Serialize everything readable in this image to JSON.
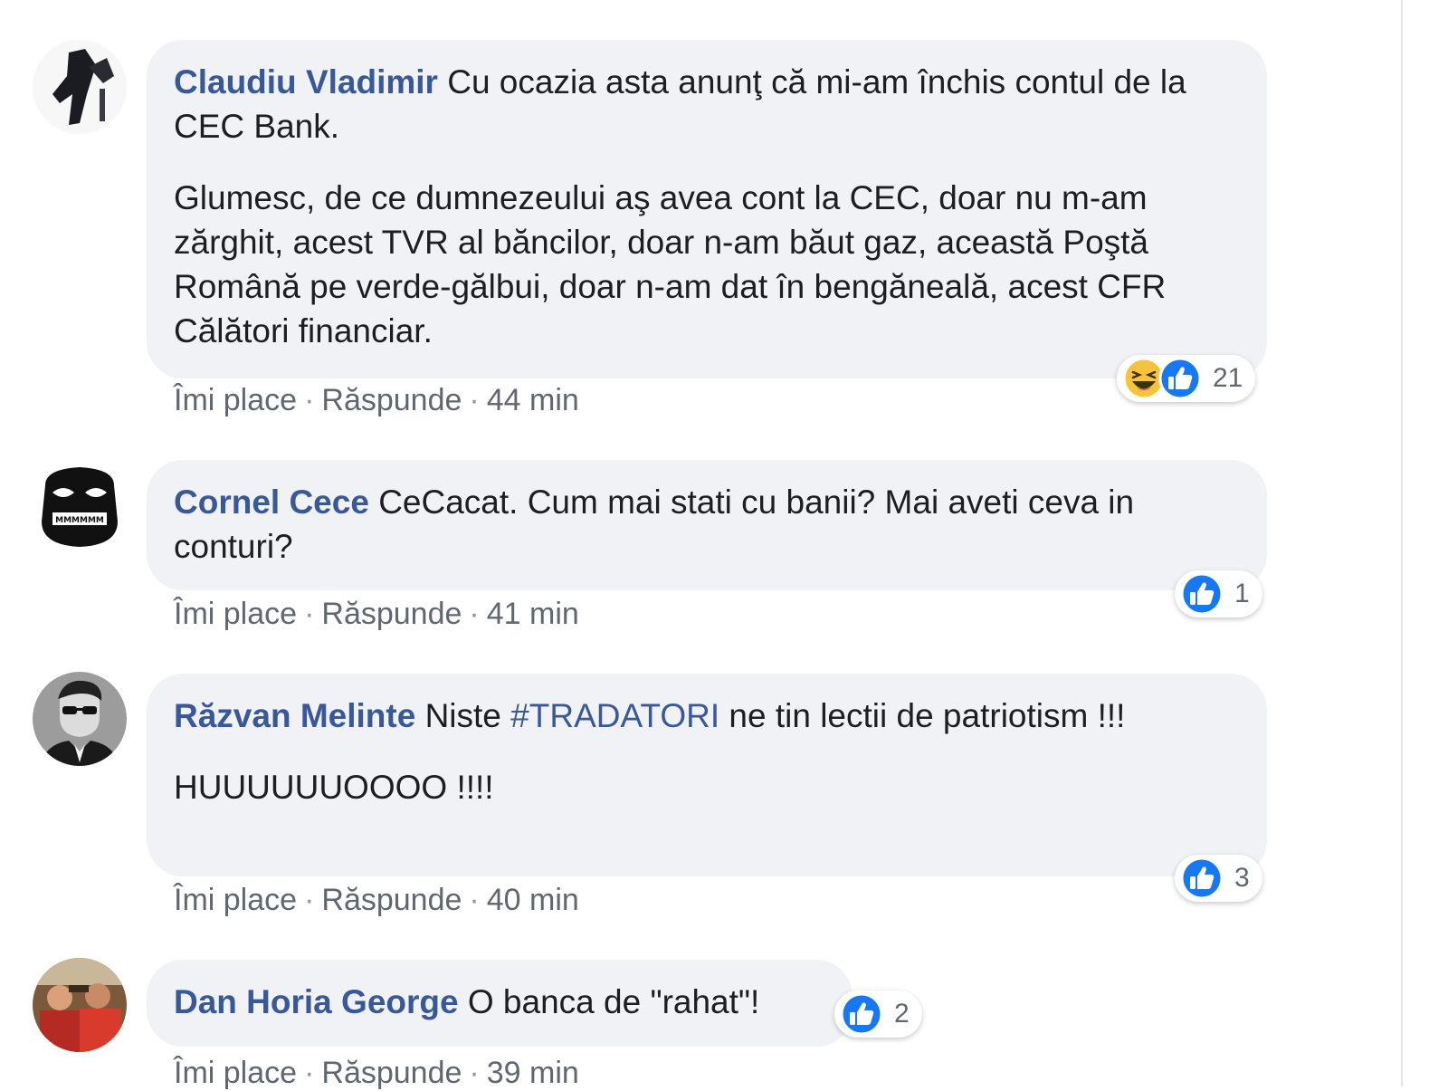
{
  "comments": [
    {
      "author": "Claudiu Vladimir",
      "text_first": "Cu ocazia asta anunţ că mi-am închis contul de la CEC Bank.",
      "text_second": "Glumesc, de ce dumnezeului aş avea cont la CEC, doar nu m-am zărghit, acest TVR al băncilor, doar n-am băut gaz, această Poştă Română pe verde-gălbui, doar n-am dat în bengăneală, acest CFR Călători financiar.",
      "like": "Îmi place",
      "reply": "Răspunde",
      "time": "44 min",
      "reaction_count": "21",
      "reactions": [
        "haha-icon",
        "like-icon"
      ]
    },
    {
      "author": "Cornel Cece",
      "text_first": "CeCacat. Cum mai stati cu banii? Mai aveti ceva in conturi?",
      "like": "Îmi place",
      "reply": "Răspunde",
      "time": "41 min",
      "reaction_count": "1",
      "reactions": [
        "like-icon"
      ]
    },
    {
      "author": "Răzvan Melinte",
      "text_before_tag": "Niste",
      "hashtag": "#TRADATORI",
      "text_after_tag": "ne tin lectii de patriotism !!!",
      "text_second": "HUUUUUUOOOO !!!!",
      "like": "Îmi place",
      "reply": "Răspunde",
      "time": "40 min",
      "reaction_count": "3",
      "reactions": [
        "like-icon"
      ]
    },
    {
      "author": "Dan Horia George",
      "text_first": "O banca de \"rahat\"!",
      "like": "Îmi place",
      "reply": "Răspunde",
      "time": "39 min",
      "reaction_count": "2",
      "reactions": [
        "like-icon"
      ]
    }
  ],
  "separator": "·",
  "colors": {
    "author": "#385898",
    "bubble": "#f0f2f5",
    "meta": "#606770",
    "like_blue": "#1877f2"
  }
}
